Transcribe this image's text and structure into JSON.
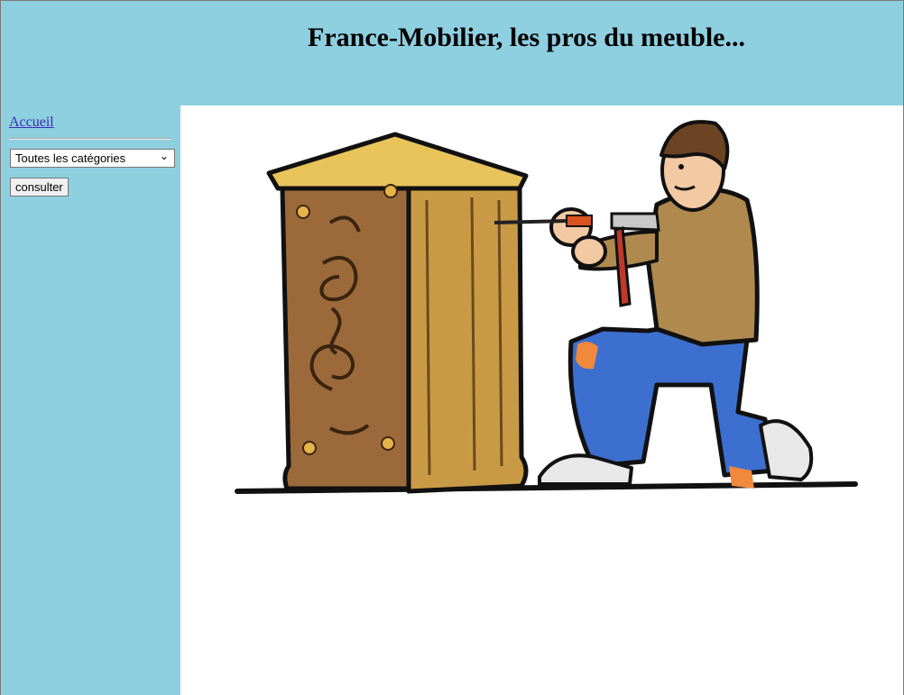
{
  "header": {
    "title": "France-Mobilier, les pros du meuble..."
  },
  "sidebar": {
    "home_link": "Accueil",
    "category_select": {
      "selected": "Toutes les catégories"
    },
    "consult_button": "consulter"
  },
  "main": {
    "illustration": "carpenter-carving-cabinet-image"
  },
  "colors": {
    "page_background": "#8ecfe0",
    "content_background": "#ffffff",
    "link": "#3b2bb5"
  }
}
